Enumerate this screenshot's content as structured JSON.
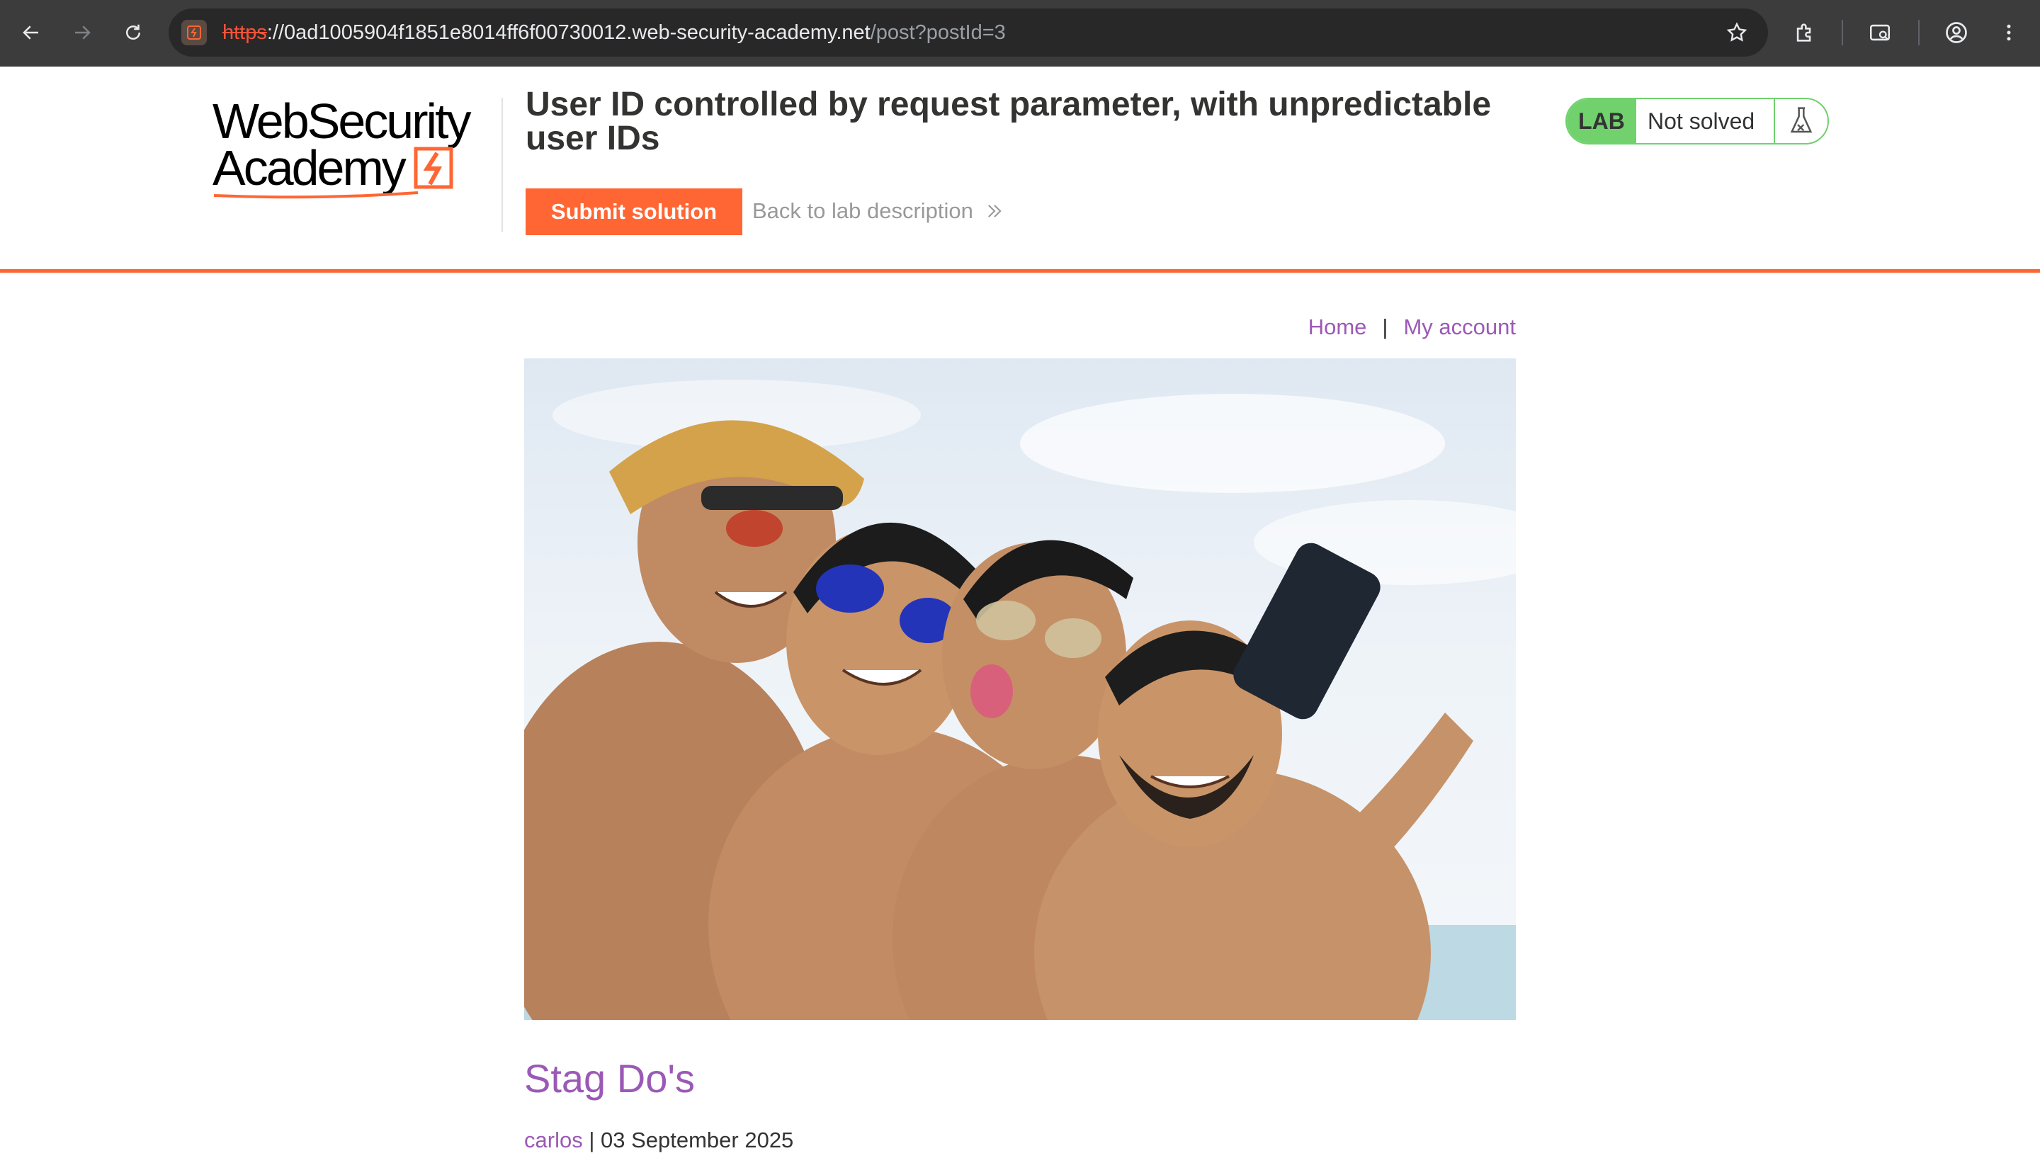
{
  "browser": {
    "url_scheme": "https",
    "url_host": "://0ad1005904f1851e8014ff6f00730012.web-security-academy.net",
    "url_path": "/post?postId=3"
  },
  "lab": {
    "logo_line1": "WebSecurity",
    "logo_line2": "Academy",
    "title": "User ID controlled by request parameter, with unpredictable user IDs",
    "submit_label": "Submit solution",
    "back_label": "Back to lab description",
    "badge": "LAB",
    "status": "Not solved"
  },
  "nav": {
    "home": "Home",
    "separator": "|",
    "account": "My account"
  },
  "post": {
    "title": "Stag Do's",
    "author": "carlos",
    "separator": " | ",
    "date": "03 September 2025"
  },
  "colors": {
    "accent": "#ff6633",
    "link": "#9b59b6",
    "lab_green": "#70d16d",
    "chrome_bg": "#3c3c3c"
  }
}
